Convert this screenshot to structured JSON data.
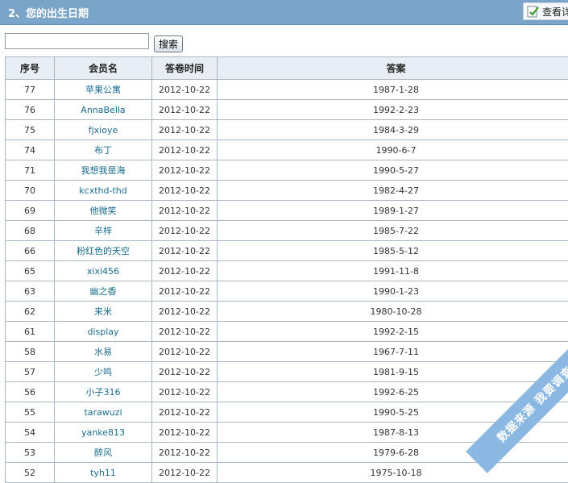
{
  "header": {
    "title": "2、您的出生日期",
    "view_button": "查看详"
  },
  "search": {
    "value": "",
    "placeholder": "",
    "button": "搜索"
  },
  "table": {
    "columns": [
      "序号",
      "会员名",
      "答卷时间",
      "答案"
    ],
    "rows": [
      {
        "id": "77",
        "member": "苹果公寓",
        "time": "2012-10-22",
        "answer": "1987-1-28"
      },
      {
        "id": "76",
        "member": "AnnaBella",
        "time": "2012-10-22",
        "answer": "1992-2-23"
      },
      {
        "id": "75",
        "member": "fjxioye",
        "time": "2012-10-22",
        "answer": "1984-3-29"
      },
      {
        "id": "74",
        "member": "布丁",
        "time": "2012-10-22",
        "answer": "1990-6-7"
      },
      {
        "id": "71",
        "member": "我想我是海",
        "time": "2012-10-22",
        "answer": "1990-5-27"
      },
      {
        "id": "70",
        "member": "kcxthd-thd",
        "time": "2012-10-22",
        "answer": "1982-4-27"
      },
      {
        "id": "69",
        "member": "他微笑",
        "time": "2012-10-22",
        "answer": "1989-1-27"
      },
      {
        "id": "68",
        "member": "辛梓",
        "time": "2012-10-22",
        "answer": "1985-7-22"
      },
      {
        "id": "66",
        "member": "粉红色的天空",
        "time": "2012-10-22",
        "answer": "1985-5-12"
      },
      {
        "id": "65",
        "member": "xixi456",
        "time": "2012-10-22",
        "answer": "1991-11-8"
      },
      {
        "id": "63",
        "member": "幽之香",
        "time": "2012-10-22",
        "answer": "1990-1-23"
      },
      {
        "id": "62",
        "member": "来米",
        "time": "2012-10-22",
        "answer": "1980-10-28"
      },
      {
        "id": "61",
        "member": "display",
        "time": "2012-10-22",
        "answer": "1992-2-15"
      },
      {
        "id": "58",
        "member": "水易",
        "time": "2012-10-22",
        "answer": "1967-7-11"
      },
      {
        "id": "57",
        "member": "少鸣",
        "time": "2012-10-22",
        "answer": "1981-9-15"
      },
      {
        "id": "56",
        "member": "小子316",
        "time": "2012-10-22",
        "answer": "1992-6-25"
      },
      {
        "id": "55",
        "member": "tarawuzi",
        "time": "2012-10-22",
        "answer": "1990-5-25"
      },
      {
        "id": "54",
        "member": "yanke813",
        "time": "2012-10-22",
        "answer": "1987-8-13"
      },
      {
        "id": "53",
        "member": "醉风",
        "time": "2012-10-22",
        "answer": "1979-6-28"
      },
      {
        "id": "52",
        "member": "tyh11",
        "time": "2012-10-22",
        "answer": "1975-10-18"
      }
    ]
  },
  "watermark": {
    "text": "数据来源 我要调查网"
  },
  "colors": {
    "header_bg": "#7aa5c8",
    "table_header_bg": "#e8eef3",
    "link": "#1a6c8e",
    "watermark": "#8ab8e3"
  },
  "icons": {
    "view_button": "view-details-icon"
  }
}
